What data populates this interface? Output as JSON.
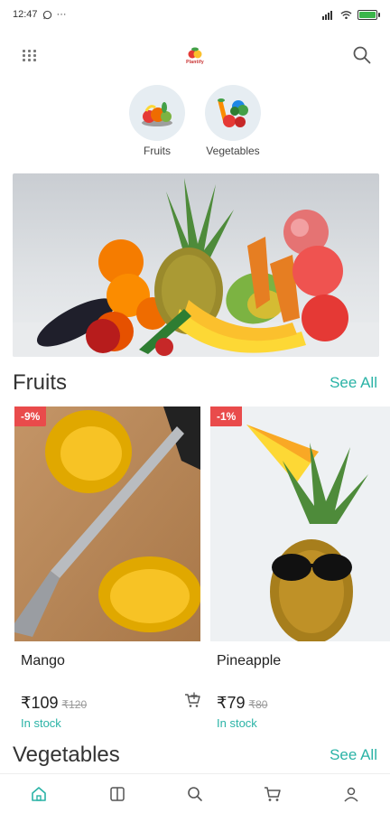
{
  "status_bar": {
    "time": "12:47",
    "extra": "···",
    "battery_color": "#3bb54a"
  },
  "header": {
    "brand": "Plantify"
  },
  "categories": [
    {
      "label": "Fruits",
      "icon": "fruits-icon"
    },
    {
      "label": "Vegetables",
      "icon": "vegetables-icon"
    }
  ],
  "banner": {
    "image": "fruits-banner-image"
  },
  "fruits_section": {
    "title": "Fruits",
    "see_all": "See All",
    "products": [
      {
        "name": "Mango",
        "discount": "-9%",
        "price": "₹109",
        "old_price": "₹120",
        "stock": "In stock",
        "image": "mango-image"
      },
      {
        "name": "Pineapple",
        "discount": "-1%",
        "price": "₹79",
        "old_price": "₹80",
        "stock": "In stock",
        "image": "pineapple-image"
      }
    ]
  },
  "vegetables_section": {
    "title": "Vegetables",
    "see_all": "See All"
  },
  "bottom_nav": [
    {
      "name": "home",
      "icon": "home-icon",
      "active": true
    },
    {
      "name": "categories",
      "icon": "book-icon",
      "active": false
    },
    {
      "name": "search",
      "icon": "search-icon",
      "active": false
    },
    {
      "name": "cart",
      "icon": "cart-icon",
      "active": false
    },
    {
      "name": "profile",
      "icon": "user-icon",
      "active": false
    }
  ],
  "colors": {
    "accent": "#2ab3a6",
    "discount": "#e94b4b"
  }
}
